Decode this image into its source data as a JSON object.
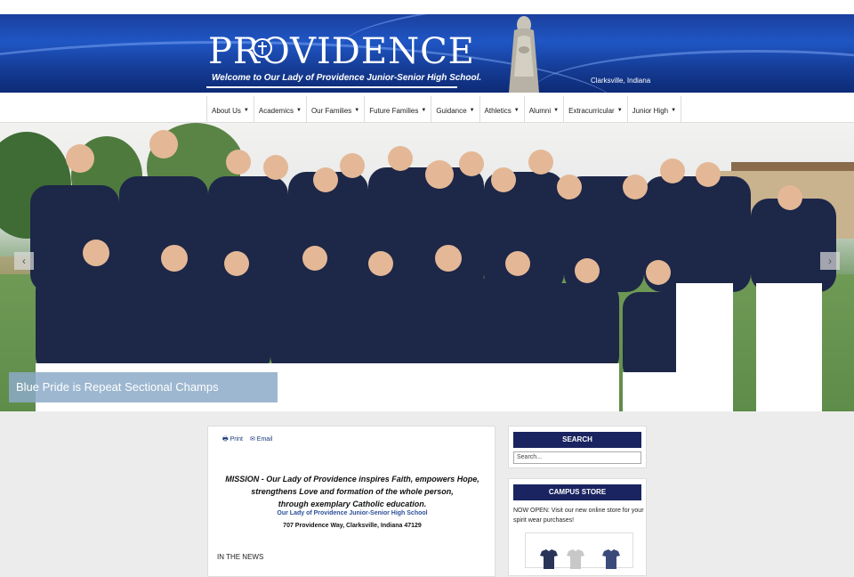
{
  "header": {
    "logo_word": "PROVIDENCE",
    "tagline": "Welcome to Our Lady of Providence Junior-Senior High School.",
    "location": "Clarksville, Indiana",
    "brand_blue": "#1b3f9e"
  },
  "nav": {
    "items": [
      {
        "label": "About Us"
      },
      {
        "label": "Academics"
      },
      {
        "label": "Our Families"
      },
      {
        "label": "Future Families"
      },
      {
        "label": "Guidance"
      },
      {
        "label": "Athletics"
      },
      {
        "label": "Alumni"
      },
      {
        "label": "Extracurricular"
      },
      {
        "label": "Junior High"
      }
    ],
    "caret_icon": "caret-down-icon"
  },
  "slider": {
    "caption": "Blue Pride is Repeat Sectional Champs",
    "prev_icon": "chevron-left-icon",
    "next_icon": "chevron-right-icon"
  },
  "content": {
    "print_label": "Print",
    "email_label": "Email",
    "mission_lines": [
      "MISSION - Our Lady of Providence inspires Faith, empowers Hope,",
      "strengthens Love and formation of the whole person,",
      "through exemplary Catholic education."
    ],
    "school_link": "Our Lady of Providence Junior-Senior High School",
    "address": "707 Providence Way, Clarksville, Indiana 47129",
    "news_heading": "IN THE NEWS"
  },
  "sidebar": {
    "search_title": "SEARCH",
    "search_placeholder": "Search...",
    "store_title": "CAMPUS STORE",
    "store_text": "NOW OPEN: Visit our new online store for your spirit wear purchases!",
    "widget_header_color": "#1a2461"
  }
}
